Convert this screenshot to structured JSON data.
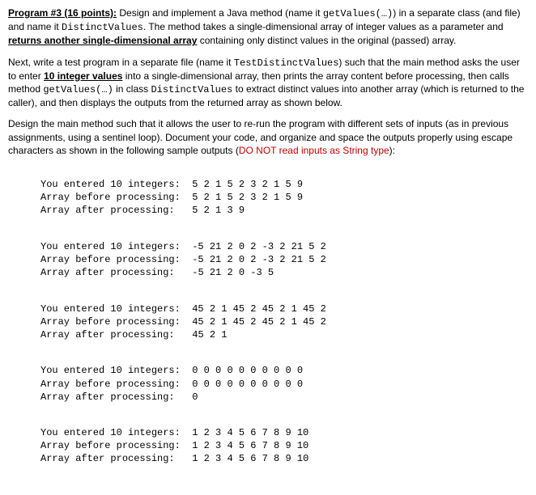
{
  "header": {
    "title": "Program #3 (16 points):",
    "intro_part1": " Design and implement a Java method (name it ",
    "code_getvalues": "getValues(…)",
    "intro_part2": ") in a separate class (and file) and name it ",
    "code_distinctvalues": "DistinctValues",
    "intro_part3": ". The method takes a single-dimensional array of integer values as a parameter and ",
    "underline_returns": "returns another single-dimensional array",
    "intro_part4": " containing only distinct values in the original (passed) array."
  },
  "para2": {
    "p1": "Next, write a test program in a separate file (name it ",
    "code_test": "TestDistinctValues",
    "p2": ") such that the main method asks the user to enter ",
    "underline_ten": "10 integer values",
    "p3": " into a single-dimensional array, then prints the array content before processing, then calls method ",
    "code_getvalues2": "getValues(…)",
    "p4": " in class ",
    "code_distinct2": "DistinctValues",
    "p5": " to extract distinct values into another array (which is returned to the caller), and then displays the outputs from the returned array as shown below."
  },
  "para3": {
    "p1": "Design the main method such that it allows the user to re-run the program with different sets of inputs (as in previous assignments, using a sentinel loop). Document your code, and organize and space the outputs properly using escape characters as shown in the following sample outputs (",
    "warn1": "DO NOT read inputs as String type",
    "p2": "):"
  },
  "labels": {
    "entered": "You entered 10 integers:",
    "before": "Array before processing:",
    "after": "Array after processing:"
  },
  "runs": [
    {
      "entered": "  5 2 1 5 2 3 2 1 5 9",
      "before": "  5 2 1 5 2 3 2 1 5 9",
      "after": "   5 2 1 3 9"
    },
    {
      "entered": "  -5 21 2 0 2 -3 2 21 5 2",
      "before": "  -5 21 2 0 2 -3 2 21 5 2",
      "after": "   -5 21 2 0 -3 5"
    },
    {
      "entered": "  45 2 1 45 2 45 2 1 45 2",
      "before": "  45 2 1 45 2 45 2 1 45 2",
      "after": "   45 2 1"
    },
    {
      "entered": "  0 0 0 0 0 0 0 0 0 0",
      "before": "  0 0 0 0 0 0 0 0 0 0",
      "after": "   0"
    },
    {
      "entered": "  1 2 3 4 5 6 7 8 9 10",
      "before": "  1 2 3 4 5 6 7 8 9 10",
      "after": "   1 2 3 4 5 6 7 8 9 10"
    }
  ]
}
